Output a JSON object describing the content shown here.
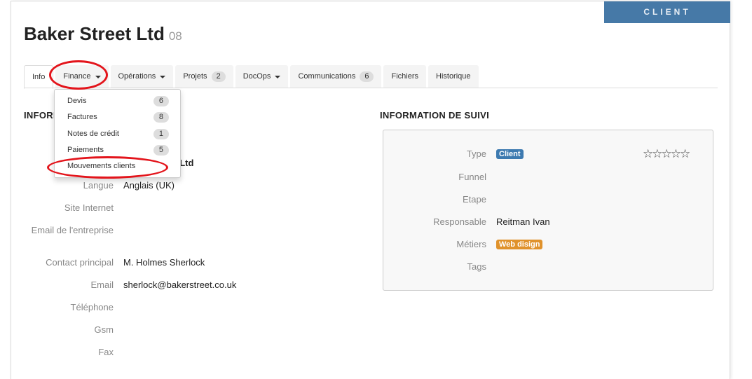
{
  "ribbon": "CLIENT",
  "title": "Baker Street Ltd",
  "title_number": "08",
  "tabs": [
    {
      "label": "Info"
    },
    {
      "label": "Finance",
      "caret": true
    },
    {
      "label": "Opérations",
      "caret": true
    },
    {
      "label": "Projets",
      "badge": "2"
    },
    {
      "label": "DocOps",
      "caret": true
    },
    {
      "label": "Communications",
      "badge": "6"
    },
    {
      "label": "Fichiers"
    },
    {
      "label": "Historique"
    }
  ],
  "finance_menu": [
    {
      "label": "Devis",
      "badge": "6"
    },
    {
      "label": "Factures",
      "badge": "8"
    },
    {
      "label": "Notes de crédit",
      "badge": "1"
    },
    {
      "label": "Paiements",
      "badge": "5"
    },
    {
      "label": "Mouvements clients"
    }
  ],
  "left": {
    "heading": "INFORMATION",
    "company_value": "Baker Street Ltd",
    "rows": [
      {
        "label": "Langue",
        "value": "Anglais (UK)"
      },
      {
        "label": "Site Internet",
        "value": ""
      },
      {
        "label": "Email de l'entreprise",
        "value": ""
      },
      {
        "label": "Contact principal",
        "value": "M. Holmes Sherlock"
      },
      {
        "label": "Email",
        "value": "sherlock@bakerstreet.co.uk"
      },
      {
        "label": "Téléphone",
        "value": ""
      },
      {
        "label": "Gsm",
        "value": ""
      },
      {
        "label": "Fax",
        "value": ""
      }
    ]
  },
  "right": {
    "heading": "INFORMATION DE SUIVI",
    "type_label": "Type",
    "type_value": "Client",
    "type_color": "#3d7ab0",
    "funnel_label": "Funnel",
    "etape_label": "Etape",
    "responsable_label": "Responsable",
    "responsable_value": "Reitman Ivan",
    "metiers_label": "Métiers",
    "metiers_value": "Web disign",
    "metiers_color": "#e0922b",
    "tags_label": "Tags",
    "rating": 0,
    "rating_max": 5,
    "stars": "☆☆☆☆☆"
  },
  "annotation_color": "#e3141b"
}
